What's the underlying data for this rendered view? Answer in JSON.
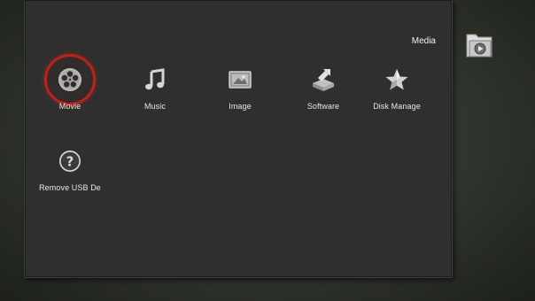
{
  "colors": {
    "panel_bg": "#2f2f2f",
    "selection_ring": "#b5241f",
    "label_text": "#e7e7e7"
  },
  "header": {
    "section_title": "Media",
    "section_icon": "media-folder-icon"
  },
  "menu": {
    "selected": "Movie",
    "items": [
      {
        "label": "Movie",
        "icon": "film-reel-icon"
      },
      {
        "label": "Music",
        "icon": "music-note-icon"
      },
      {
        "label": "Image",
        "icon": "picture-icon"
      },
      {
        "label": "Software",
        "icon": "software-install-icon"
      },
      {
        "label": "Disk Manage",
        "icon": "star-icon"
      },
      {
        "label": "Remove USB De",
        "icon": "question-mark-icon"
      }
    ]
  }
}
